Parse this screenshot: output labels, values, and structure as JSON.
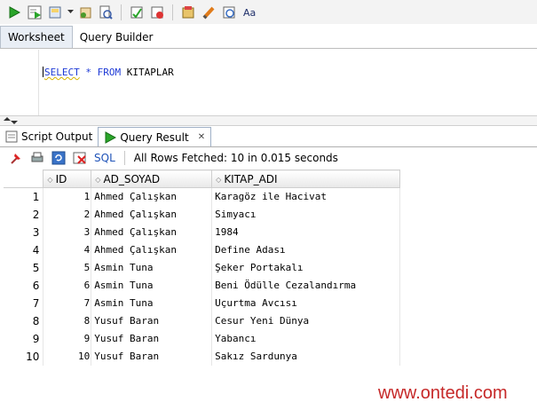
{
  "toolbar": {
    "buttons": [
      "run-statement-icon",
      "run-script-icon",
      "commit-icon",
      "rollback-icon",
      "explain-icon",
      "autotrace-icon",
      "sql-tuning-icon",
      "clear-icon",
      "format-icon",
      "history-icon",
      "case-icon"
    ]
  },
  "worksheet_tabs": [
    {
      "label": "Worksheet",
      "active": true
    },
    {
      "label": "Query Builder",
      "active": false
    }
  ],
  "editor": {
    "kw_select": "SELECT",
    "star": " * ",
    "kw_from": "FROM",
    "table": " KITAPLAR"
  },
  "output_tabs": [
    {
      "label": "Script Output",
      "active": false
    },
    {
      "label": "Query Result",
      "active": true
    }
  ],
  "result_toolbar": {
    "sql_label": "SQL",
    "fetch_message": "All Rows Fetched: 10 in 0.015 seconds"
  },
  "grid": {
    "columns": [
      "ID",
      "AD_SOYAD",
      "KITAP_ADI"
    ],
    "rows": [
      {
        "row_num": "1",
        "id": "1",
        "ad_soyad": "Ahmed Çalışkan",
        "kitap_adi": "Karagöz ile Hacivat"
      },
      {
        "row_num": "2",
        "id": "2",
        "ad_soyad": "Ahmed Çalışkan",
        "kitap_adi": "Simyacı"
      },
      {
        "row_num": "3",
        "id": "3",
        "ad_soyad": "Ahmed Çalışkan",
        "kitap_adi": "1984"
      },
      {
        "row_num": "4",
        "id": "4",
        "ad_soyad": "Ahmed Çalışkan",
        "kitap_adi": "Define Adası"
      },
      {
        "row_num": "5",
        "id": "5",
        "ad_soyad": "Asmin Tuna",
        "kitap_adi": "Şeker Portakalı"
      },
      {
        "row_num": "6",
        "id": "6",
        "ad_soyad": "Asmin Tuna",
        "kitap_adi": "Beni Ödülle Cezalandırma"
      },
      {
        "row_num": "7",
        "id": "7",
        "ad_soyad": "Asmin Tuna",
        "kitap_adi": "Uçurtma Avcısı"
      },
      {
        "row_num": "8",
        "id": "8",
        "ad_soyad": "Yusuf Baran",
        "kitap_adi": "Cesur Yeni Dünya"
      },
      {
        "row_num": "9",
        "id": "9",
        "ad_soyad": "Yusuf Baran",
        "kitap_adi": "Yabancı"
      },
      {
        "row_num": "10",
        "id": "10",
        "ad_soyad": "Yusuf Baran",
        "kitap_adi": "Sakız Sardunya"
      }
    ]
  },
  "watermark": "www.ontedi.com",
  "colors": {
    "keyword": "#1f3bd6",
    "run_green": "#2aa52a",
    "watermark": "#c62828"
  }
}
